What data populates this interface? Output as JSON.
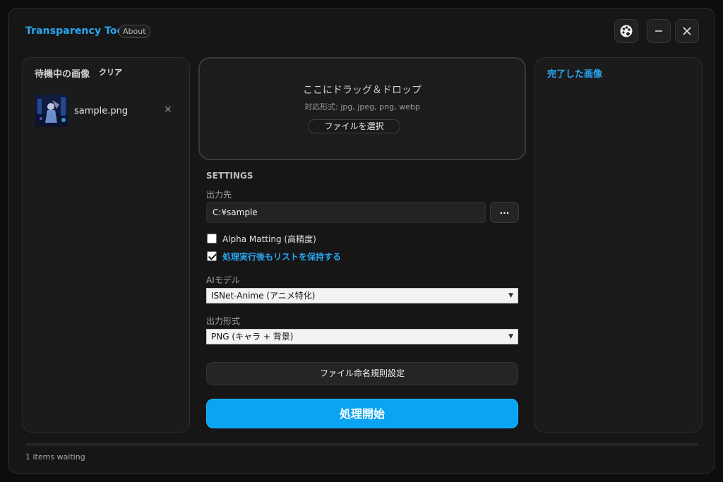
{
  "header": {
    "title": "Transparency Tool",
    "about_label": "About",
    "buttons": {
      "theme": "palette-icon",
      "minimize": "minimize-icon",
      "close": "close-icon"
    }
  },
  "queue_panel": {
    "title": "待機中の画像",
    "clear_label": "クリア",
    "items": [
      {
        "name": "sample.png",
        "remove_label": "×"
      }
    ]
  },
  "drop_zone": {
    "text": "ここにドラッグ＆ドロップ",
    "formats": "対応形式: jpg, jpeg, png, webp",
    "select_label": "ファイルを選択"
  },
  "settings": {
    "section_label": "SETTINGS",
    "output_label": "出力先",
    "output_path": "C:¥sample",
    "browse_label": "...",
    "alpha_matting": {
      "label": "Alpha Matting (高精度)",
      "checked": false
    },
    "keep_list": {
      "label": "処理実行後もリストを保持する",
      "checked": true
    },
    "model_label": "AIモデル",
    "model_value": "ISNet-Anime (アニメ特化)",
    "format_label": "出力形式",
    "format_value": "PNG (キャラ + 背景)",
    "naming_label": "ファイル命名規則設定",
    "start_label": "処理開始"
  },
  "completed_panel": {
    "title": "完了した画像"
  },
  "status": {
    "text": "1 items waiting",
    "progress": 0
  },
  "colors": {
    "accent": "#2aa6f0",
    "start_button": "#0aa4f5",
    "background": "#161616"
  }
}
